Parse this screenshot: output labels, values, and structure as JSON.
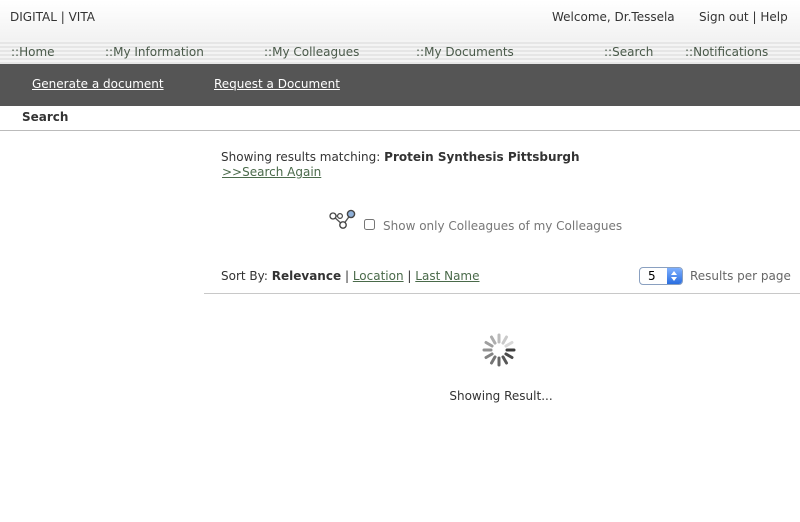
{
  "header": {
    "brand": "DIGITAL | VITA",
    "welcome": "Welcome, Dr.Tessela",
    "sign_out": "Sign out",
    "separator": "|",
    "help": "Help"
  },
  "nav": {
    "items": [
      {
        "label": "::Home"
      },
      {
        "label": "::My Information"
      },
      {
        "label": "::My Colleagues"
      },
      {
        "label": "::My Documents"
      },
      {
        "label": "::Search"
      },
      {
        "label": "::Notifications"
      }
    ]
  },
  "subnav": {
    "generate": "Generate a document",
    "request": "Request a Document"
  },
  "breadcrumb": {
    "title": "Search"
  },
  "search": {
    "matching_prefix": "Showing results matching:",
    "query": "Protein Synthesis Pittsburgh",
    "again": ">>Search Again",
    "filter_label": "Show only Colleagues of my Colleagues",
    "filter_checked": false
  },
  "sort": {
    "label": "Sort By:",
    "current": "Relevance",
    "sep": "|",
    "location": "Location",
    "last_name": "Last Name"
  },
  "paging": {
    "per_page_value": "5",
    "per_page_label": "Results per page"
  },
  "status": {
    "loading_text": "Showing Result..."
  },
  "icons": {
    "network": "network-icon",
    "spinner": "loading-spinner-icon"
  }
}
